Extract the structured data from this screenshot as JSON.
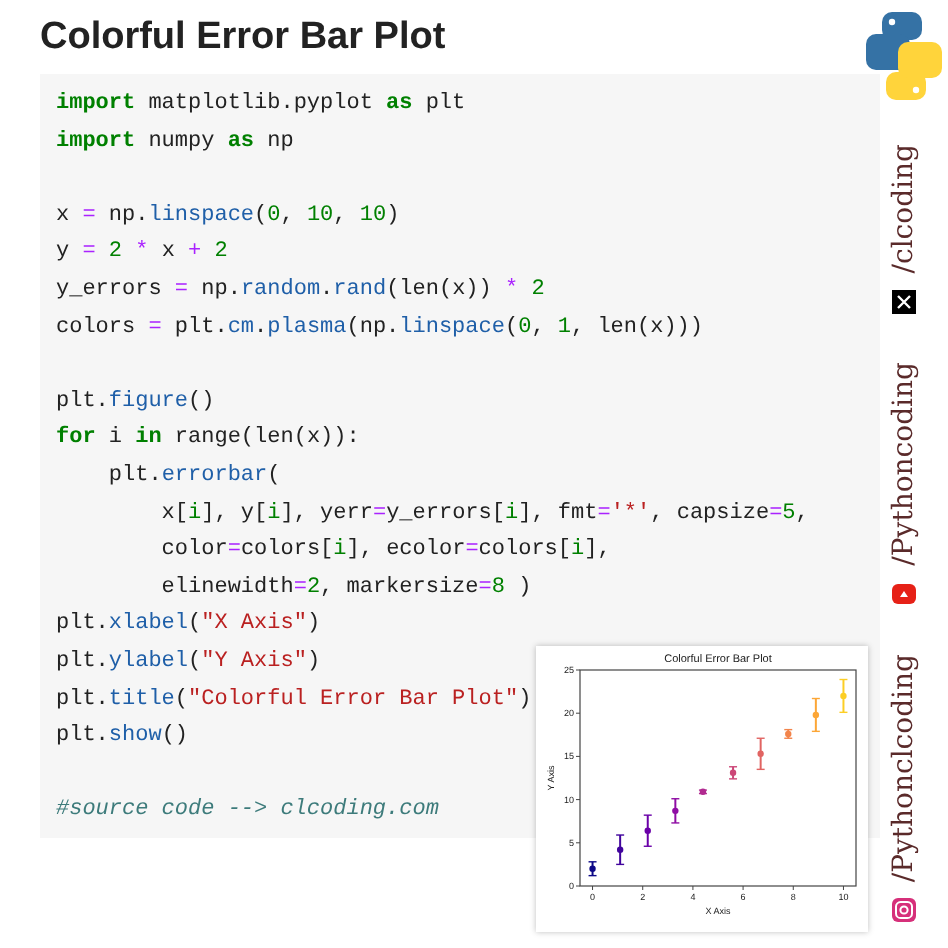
{
  "title": "Colorful Error Bar Plot",
  "code_blocks": [
    [
      [
        {
          "kind": "keyword",
          "text": "import"
        },
        {
          "kind": "plain",
          "text": " matplotlib.pyplot "
        },
        {
          "kind": "keyword",
          "text": "as"
        },
        {
          "kind": "plain",
          "text": " plt"
        }
      ],
      [
        {
          "kind": "keyword",
          "text": "import"
        },
        {
          "kind": "plain",
          "text": " numpy "
        },
        {
          "kind": "keyword",
          "text": "as"
        },
        {
          "kind": "plain",
          "text": " np"
        }
      ]
    ],
    [
      [
        {
          "kind": "plain",
          "text": "x "
        },
        {
          "kind": "operator",
          "text": "= "
        },
        {
          "kind": "plain",
          "text": "np."
        },
        {
          "kind": "function",
          "text": "linspace"
        },
        {
          "kind": "plain",
          "text": "("
        },
        {
          "kind": "number",
          "text": "0"
        },
        {
          "kind": "plain",
          "text": ", "
        },
        {
          "kind": "number",
          "text": "10"
        },
        {
          "kind": "plain",
          "text": ", "
        },
        {
          "kind": "number",
          "text": "10"
        },
        {
          "kind": "plain",
          "text": ")"
        }
      ],
      [
        {
          "kind": "plain",
          "text": "y "
        },
        {
          "kind": "operator",
          "text": "= "
        },
        {
          "kind": "number",
          "text": "2 "
        },
        {
          "kind": "operator",
          "text": "* "
        },
        {
          "kind": "plain",
          "text": "x "
        },
        {
          "kind": "operator",
          "text": "+ "
        },
        {
          "kind": "number",
          "text": "2"
        }
      ],
      [
        {
          "kind": "plain",
          "text": "y_errors "
        },
        {
          "kind": "operator",
          "text": "= "
        },
        {
          "kind": "plain",
          "text": "np."
        },
        {
          "kind": "function",
          "text": "random"
        },
        {
          "kind": "plain",
          "text": "."
        },
        {
          "kind": "function",
          "text": "rand"
        },
        {
          "kind": "plain",
          "text": "(len(x)) "
        },
        {
          "kind": "operator",
          "text": "* "
        },
        {
          "kind": "number",
          "text": "2"
        }
      ],
      [
        {
          "kind": "plain",
          "text": "colors "
        },
        {
          "kind": "operator",
          "text": "= "
        },
        {
          "kind": "plain",
          "text": "plt."
        },
        {
          "kind": "function",
          "text": "cm"
        },
        {
          "kind": "plain",
          "text": "."
        },
        {
          "kind": "function",
          "text": "plasma"
        },
        {
          "kind": "plain",
          "text": "(np."
        },
        {
          "kind": "function",
          "text": "linspace"
        },
        {
          "kind": "plain",
          "text": "("
        },
        {
          "kind": "number",
          "text": "0"
        },
        {
          "kind": "plain",
          "text": ", "
        },
        {
          "kind": "number",
          "text": "1"
        },
        {
          "kind": "plain",
          "text": ", len(x)))"
        }
      ]
    ],
    [
      [
        {
          "kind": "plain",
          "text": "plt."
        },
        {
          "kind": "function",
          "text": "figure"
        },
        {
          "kind": "plain",
          "text": "()"
        }
      ],
      [
        {
          "kind": "keyword",
          "text": "for"
        },
        {
          "kind": "plain",
          "text": " i "
        },
        {
          "kind": "keyword",
          "text": "in"
        },
        {
          "kind": "plain",
          "text": " range(len(x)):"
        }
      ],
      [
        {
          "kind": "plain",
          "text": "    plt."
        },
        {
          "kind": "function",
          "text": "errorbar"
        },
        {
          "kind": "plain",
          "text": "("
        }
      ],
      [
        {
          "kind": "plain",
          "text": "        x["
        },
        {
          "kind": "number",
          "text": "i"
        },
        {
          "kind": "plain",
          "text": "], y["
        },
        {
          "kind": "number",
          "text": "i"
        },
        {
          "kind": "plain",
          "text": "], yerr"
        },
        {
          "kind": "operator",
          "text": "="
        },
        {
          "kind": "plain",
          "text": "y_errors["
        },
        {
          "kind": "number",
          "text": "i"
        },
        {
          "kind": "plain",
          "text": "], fmt"
        },
        {
          "kind": "operator",
          "text": "="
        },
        {
          "kind": "string",
          "text": "'*'"
        },
        {
          "kind": "plain",
          "text": ", capsize"
        },
        {
          "kind": "operator",
          "text": "="
        },
        {
          "kind": "number",
          "text": "5"
        },
        {
          "kind": "plain",
          "text": ","
        }
      ],
      [
        {
          "kind": "plain",
          "text": "        color"
        },
        {
          "kind": "operator",
          "text": "="
        },
        {
          "kind": "plain",
          "text": "colors["
        },
        {
          "kind": "number",
          "text": "i"
        },
        {
          "kind": "plain",
          "text": "], ecolor"
        },
        {
          "kind": "operator",
          "text": "="
        },
        {
          "kind": "plain",
          "text": "colors["
        },
        {
          "kind": "number",
          "text": "i"
        },
        {
          "kind": "plain",
          "text": "],"
        }
      ],
      [
        {
          "kind": "plain",
          "text": "        elinewidth"
        },
        {
          "kind": "operator",
          "text": "="
        },
        {
          "kind": "number",
          "text": "2"
        },
        {
          "kind": "plain",
          "text": ", markersize"
        },
        {
          "kind": "operator",
          "text": "="
        },
        {
          "kind": "number",
          "text": "8"
        },
        {
          "kind": "plain",
          "text": " )"
        }
      ],
      [
        {
          "kind": "plain",
          "text": "plt."
        },
        {
          "kind": "function",
          "text": "xlabel"
        },
        {
          "kind": "plain",
          "text": "("
        },
        {
          "kind": "string",
          "text": "\"X Axis\""
        },
        {
          "kind": "plain",
          "text": ")"
        }
      ],
      [
        {
          "kind": "plain",
          "text": "plt."
        },
        {
          "kind": "function",
          "text": "ylabel"
        },
        {
          "kind": "plain",
          "text": "("
        },
        {
          "kind": "string",
          "text": "\"Y Axis\""
        },
        {
          "kind": "plain",
          "text": ")"
        }
      ],
      [
        {
          "kind": "plain",
          "text": "plt."
        },
        {
          "kind": "function",
          "text": "title"
        },
        {
          "kind": "plain",
          "text": "("
        },
        {
          "kind": "string",
          "text": "\"Colorful Error Bar Plot\""
        },
        {
          "kind": "plain",
          "text": ")"
        }
      ],
      [
        {
          "kind": "plain",
          "text": "plt."
        },
        {
          "kind": "function",
          "text": "show"
        },
        {
          "kind": "plain",
          "text": "()"
        }
      ]
    ],
    [
      [
        {
          "kind": "comment",
          "text": "#source code --> clcoding.com"
        }
      ]
    ]
  ],
  "chart": {
    "chart_data": {
      "type": "scatter",
      "title": "Colorful Error Bar Plot",
      "xlabel": "X Axis",
      "ylabel": "Y Axis",
      "x": [
        0,
        1.1,
        2.2,
        3.3,
        4.4,
        5.6,
        6.7,
        7.8,
        8.9,
        10
      ],
      "series": [
        {
          "values": [
            2,
            4.2,
            6.4,
            8.7,
            10.9,
            13.1,
            15.3,
            17.6,
            19.8,
            22
          ],
          "errors": [
            0.8,
            1.7,
            1.8,
            1.4,
            0.2,
            0.7,
            1.8,
            0.5,
            1.9,
            1.9
          ],
          "colors": [
            "#0d0887",
            "#41049d",
            "#6a00a8",
            "#8f0da4",
            "#b12a90",
            "#cc4778",
            "#e16462",
            "#f2844b",
            "#fca636",
            "#fcce25"
          ]
        }
      ],
      "xlim": [
        -0.5,
        10.5
      ],
      "ylim": [
        0,
        25
      ],
      "xticks": [
        0,
        2,
        4,
        6,
        8,
        10
      ],
      "yticks": [
        0,
        5,
        10,
        15,
        20,
        25
      ]
    }
  },
  "social": [
    {
      "kind": "x",
      "handle": "/clcoding"
    },
    {
      "kind": "youtube",
      "handle": "/Pythoncoding"
    },
    {
      "kind": "instagram",
      "handle": "/Pythonclcoding"
    }
  ]
}
